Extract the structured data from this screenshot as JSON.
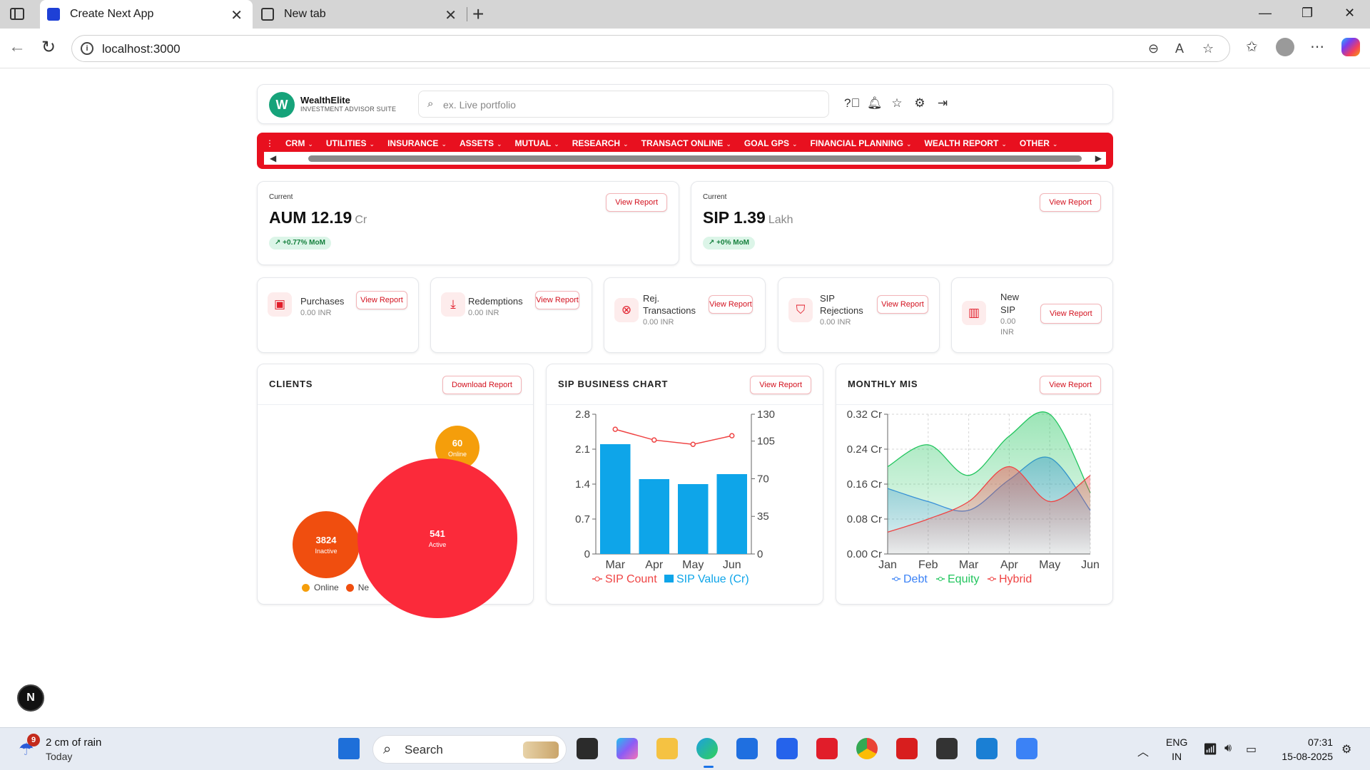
{
  "browser": {
    "tabs": [
      {
        "title": "Create Next App",
        "active": true
      },
      {
        "title": "New tab",
        "active": false
      }
    ],
    "url": "localhost:3000"
  },
  "app": {
    "brand": "WealthElite",
    "brand_sub": "INVESTMENT ADVISOR SUITE",
    "logo_letter": "W",
    "search_placeholder": "ex. Live portfolio",
    "menu": [
      "CRM",
      "UTILITIES",
      "INSURANCE",
      "ASSETS",
      "MUTUAL",
      "RESEARCH",
      "TRANSACT ONLINE",
      "GOAL GPS",
      "FINANCIAL PLANNING",
      "WEALTH REPORT",
      "OTHER"
    ],
    "stats": [
      {
        "label": "Current",
        "metric": "AUM 12.19",
        "unit": "Cr",
        "change": "+0.77% MoM",
        "button": "View Report"
      },
      {
        "label": "Current",
        "metric": "SIP 1.39",
        "unit": "Lakh",
        "change": "+0% MoM",
        "button": "View Report"
      }
    ],
    "mini": [
      {
        "title": "Purchases",
        "amount": "0.00 INR",
        "button": "View Report"
      },
      {
        "title": "Redemptions",
        "amount": "0.00 INR",
        "button": "View Report"
      },
      {
        "title_l1": "Rej.",
        "title_l2": "Transactions",
        "amount": "0.00 INR",
        "button": "View Report"
      },
      {
        "title_l1": "SIP",
        "title_l2": "Rejections",
        "amount": "0.00 INR",
        "button": "View Report"
      },
      {
        "title_l1": "New",
        "title_l2": "SIP",
        "amount_l1": "0.00",
        "amount_l2": "INR",
        "button": "View Report"
      }
    ],
    "panels": {
      "clients": {
        "title": "CLIENTS",
        "button": "Download Report"
      },
      "sip": {
        "title": "SIP BUSINESS CHART",
        "button": "View Report"
      },
      "mis": {
        "title": "MONTHLY MIS",
        "button": "View Report"
      }
    },
    "next_badge": "N"
  },
  "chart_data": [
    {
      "type": "bubble",
      "title": "CLIENTS",
      "bubbles": [
        {
          "label": "Online",
          "value": 60
        },
        {
          "label": "Inactive",
          "value": 3824
        },
        {
          "label": "Active",
          "value": 541
        }
      ],
      "legend": [
        "Online",
        "Ne"
      ],
      "colors": {
        "Online": "#f59e0b",
        "Inactive": "#f04e0f",
        "Active": "#fb2a3a"
      }
    },
    {
      "type": "bar",
      "title": "SIP BUSINESS CHART",
      "categories": [
        "Mar",
        "Apr",
        "May",
        "Jun"
      ],
      "series": [
        {
          "name": "SIP Count",
          "kind": "line",
          "axis": "right",
          "values": [
            116,
            106,
            102,
            110
          ],
          "color": "#ef4444"
        },
        {
          "name": "SIP Value (Cr)",
          "kind": "bar",
          "axis": "left",
          "values": [
            2.2,
            1.5,
            1.4,
            1.6
          ],
          "color": "#0ea5e9"
        }
      ],
      "yleft": {
        "min": 0,
        "max": 2.8,
        "ticks": [
          "0",
          "0.7",
          "1.4",
          "2.1",
          "2.8"
        ]
      },
      "yright": {
        "min": 0,
        "max": 130,
        "ticks": [
          "0",
          "35",
          "70",
          "105",
          "130"
        ]
      }
    },
    {
      "type": "area",
      "title": "MONTHLY MIS",
      "categories": [
        "Jan",
        "Feb",
        "Mar",
        "Apr",
        "May",
        "Jun"
      ],
      "series": [
        {
          "name": "Debt",
          "values": [
            0.15,
            0.12,
            0.1,
            0.17,
            0.22,
            0.1
          ],
          "color": "#3b82f6"
        },
        {
          "name": "Equity",
          "values": [
            0.2,
            0.25,
            0.18,
            0.27,
            0.32,
            0.14
          ],
          "color": "#22c55e"
        },
        {
          "name": "Hybrid",
          "values": [
            0.05,
            0.08,
            0.12,
            0.2,
            0.12,
            0.18
          ],
          "color": "#ef4444"
        }
      ],
      "ylim": [
        0,
        0.32
      ],
      "yticks": [
        "0.00 Cr",
        "0.08 Cr",
        "0.16 Cr",
        "0.24 Cr",
        "0.32 Cr"
      ]
    }
  ],
  "taskbar": {
    "weather_badge": "9",
    "weather_title": "2 cm of rain",
    "weather_sub": "Today",
    "search": "Search",
    "lang_1": "ENG",
    "lang_2": "IN",
    "time": "07:31",
    "date": "15-08-2025"
  }
}
